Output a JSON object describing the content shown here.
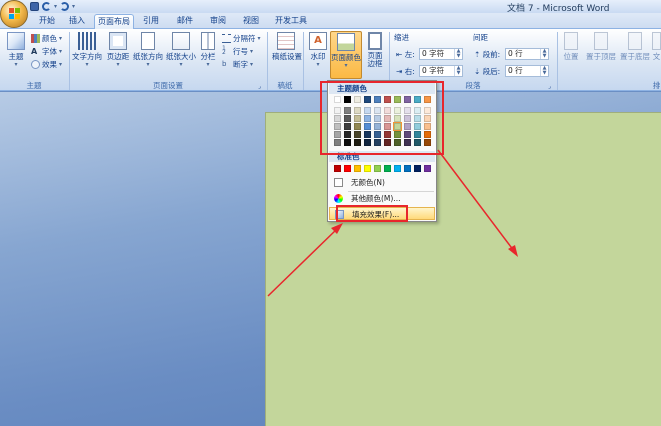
{
  "window": {
    "title": "文档 7 - Microsoft Word"
  },
  "tabs": [
    "开始",
    "插入",
    "页面布局",
    "引用",
    "邮件",
    "审阅",
    "视图",
    "开发工具"
  ],
  "active_tab": "页面布局",
  "ribbon": {
    "theme_group": {
      "label": "主题",
      "theme_button": "主题",
      "colors": "颜色",
      "fonts": "字体",
      "effects": "效果"
    },
    "page_setup_group": {
      "label": "页面设置",
      "text_direction": "文字方向",
      "margins": "页边距",
      "orientation": "纸张方向",
      "size": "纸张大小",
      "columns": "分栏",
      "breaks": "分隔符",
      "line_numbers": "行号",
      "hyphenation": "断字"
    },
    "draft_group": {
      "label": "稿纸",
      "draft_settings": "稿纸设置"
    },
    "background_group": {
      "watermark": "水印",
      "page_color": "页面颜色",
      "page_borders": "页面边框"
    },
    "paragraph_group": {
      "label": "段落",
      "indent": "缩进",
      "spacing": "间距",
      "left": "左:",
      "right": "右:",
      "before": "段前:",
      "after": "段后:",
      "left_value": "0 字符",
      "right_value": "0 字符",
      "before_value": "0 行",
      "after_value": "0 行"
    },
    "arrange_group": {
      "position": "位置",
      "bring_front": "置于顶层",
      "send_back": "置于底层",
      "wrap": "文",
      "arrange_label": "排"
    }
  },
  "dropdown": {
    "theme_colors_header": "主题颜色",
    "standard_colors_header": "标准色",
    "no_color": "无颜色(N)",
    "more_colors": "其他颜色(M)...",
    "fill_effects": "填充效果(F)...",
    "theme_colors_top": [
      "#ffffff",
      "#000000",
      "#eeece1",
      "#1f497d",
      "#4f81bd",
      "#c0504d",
      "#9bbb59",
      "#8064a2",
      "#4bacc6",
      "#f79646"
    ],
    "theme_colors_shades": [
      [
        "#f2f2f2",
        "#7f7f7f",
        "#ddd9c3",
        "#c6d9f0",
        "#dbe5f1",
        "#f2dcdb",
        "#ebf1dd",
        "#e5e0ec",
        "#dbeef3",
        "#fdeada"
      ],
      [
        "#d8d8d8",
        "#595959",
        "#c4bd97",
        "#8db3e2",
        "#b8cce4",
        "#e5b9b7",
        "#d7e3bc",
        "#ccc1d9",
        "#b7dde8",
        "#fbd5b5"
      ],
      [
        "#bfbfbf",
        "#3f3f3f",
        "#938953",
        "#548dd4",
        "#95b3d7",
        "#d99694",
        "#c3d69b",
        "#b2a2c7",
        "#92cddc",
        "#fac08f"
      ],
      [
        "#a5a5a5",
        "#262626",
        "#494429",
        "#17365d",
        "#366092",
        "#953734",
        "#76923c",
        "#5f497a",
        "#31859b",
        "#e36c09"
      ],
      [
        "#7f7f7f",
        "#0c0c0c",
        "#1d1b10",
        "#0f243e",
        "#244061",
        "#632423",
        "#4f6128",
        "#3f3151",
        "#205867",
        "#974806"
      ]
    ],
    "standard_colors": [
      "#c00000",
      "#ff0000",
      "#ffc000",
      "#ffff00",
      "#92d050",
      "#00b050",
      "#00b0f0",
      "#0070c0",
      "#002060",
      "#7030a0"
    ],
    "selected_color": "#c3d69b"
  },
  "document": {
    "page_color": "#c3d69b"
  },
  "annotation_color": "#e8262c"
}
